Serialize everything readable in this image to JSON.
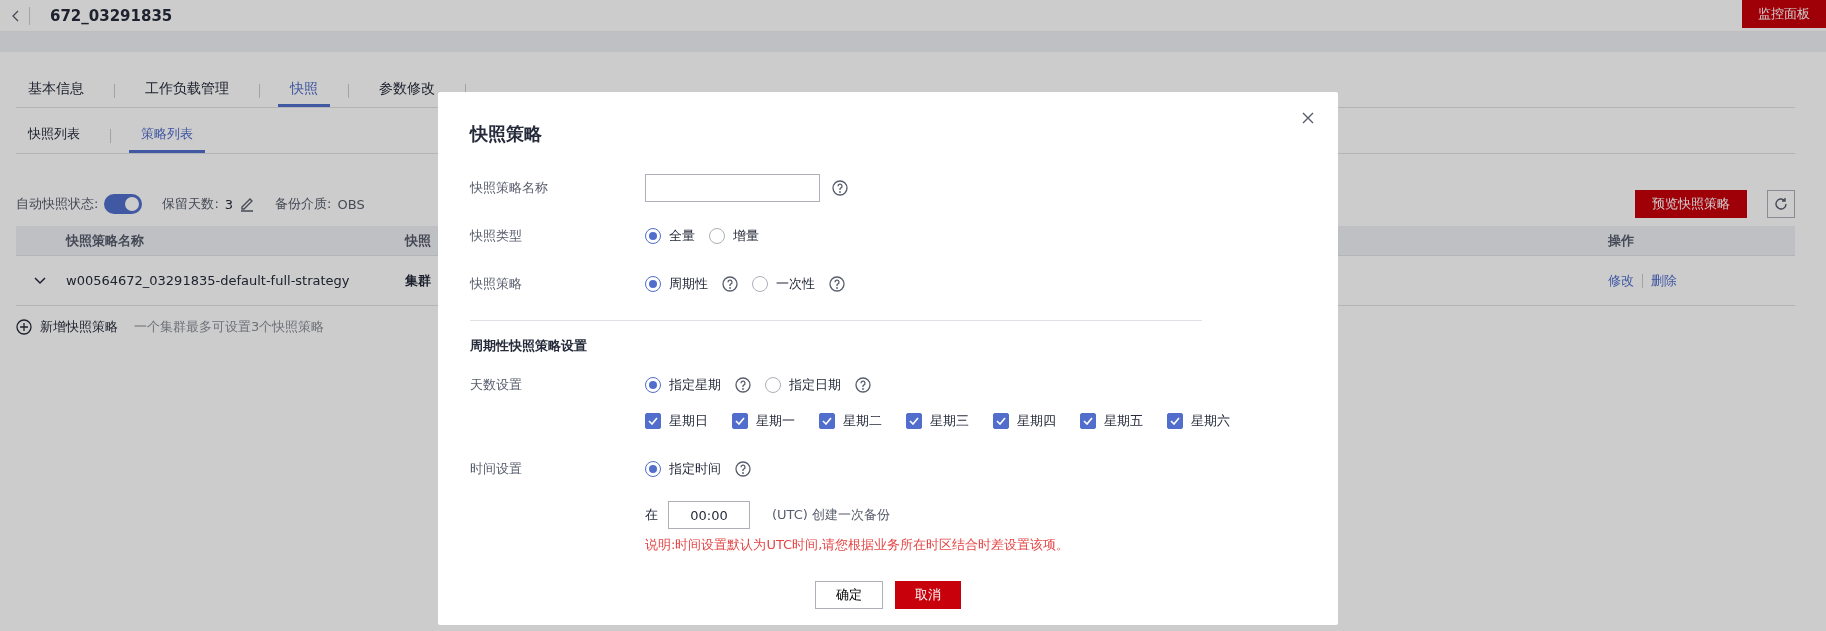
{
  "header": {
    "title": "672_03291835",
    "monitor_button": "监控面板"
  },
  "tabs": [
    {
      "label": "基本信息",
      "selected": false
    },
    {
      "label": "工作负载管理",
      "selected": false
    },
    {
      "label": "快照",
      "selected": true
    },
    {
      "label": "参数修改",
      "selected": false
    }
  ],
  "subtabs": [
    {
      "label": "快照列表",
      "selected": false
    },
    {
      "label": "策略列表",
      "selected": true
    }
  ],
  "toolbar": {
    "auto_label": "自动快照状态:",
    "auto_on": true,
    "retain_label": "保留天数:",
    "retain_value": "3",
    "medium_label": "备份介质:",
    "medium_value": "OBS",
    "preview_button": "预览快照策略"
  },
  "table": {
    "columns": [
      "快照策略名称",
      "快照",
      "操作"
    ],
    "rows": [
      {
        "expanded": false,
        "cells": [
          "w00564672_03291835-default-full-strategy",
          "集群"
        ],
        "actions": [
          "修改",
          "删除"
        ]
      }
    ]
  },
  "add": {
    "label": "新增快照策略",
    "hint": "一个集群最多可设置3个快照策略"
  },
  "dialog": {
    "title": "快照策略",
    "name_field": {
      "label": "快照策略名称"
    },
    "type": {
      "label": "快照类型",
      "options": [
        {
          "label": "全量",
          "selected": true,
          "help": false
        },
        {
          "label": "增量",
          "selected": false,
          "help": false
        }
      ]
    },
    "strategy": {
      "label": "快照策略",
      "options": [
        {
          "label": "周期性",
          "selected": true,
          "help": true
        },
        {
          "label": "一次性",
          "selected": false,
          "help": true
        }
      ]
    },
    "section_title": "周期性快照策略设置",
    "days": {
      "label": "天数设置",
      "modes": [
        {
          "label": "指定星期",
          "selected": true,
          "help": true
        },
        {
          "label": "指定日期",
          "selected": false,
          "help": true
        }
      ],
      "weekdays": [
        {
          "label": "星期日",
          "checked": true
        },
        {
          "label": "星期一",
          "checked": true
        },
        {
          "label": "星期二",
          "checked": true
        },
        {
          "label": "星期三",
          "checked": true
        },
        {
          "label": "星期四",
          "checked": true
        },
        {
          "label": "星期五",
          "checked": true
        },
        {
          "label": "星期六",
          "checked": true
        }
      ]
    },
    "time": {
      "label": "时间设置",
      "modes": [
        {
          "label": "指定时间",
          "selected": true,
          "help": true
        }
      ],
      "prefix": "在",
      "value": "00:00",
      "suffix": "(UTC) 创建一次备份",
      "note": "说明:时间设置默认为UTC时间,请您根据业务所在时区结合时差设置该项。"
    },
    "buttons": {
      "confirm": "确定",
      "cancel": "取消"
    }
  }
}
